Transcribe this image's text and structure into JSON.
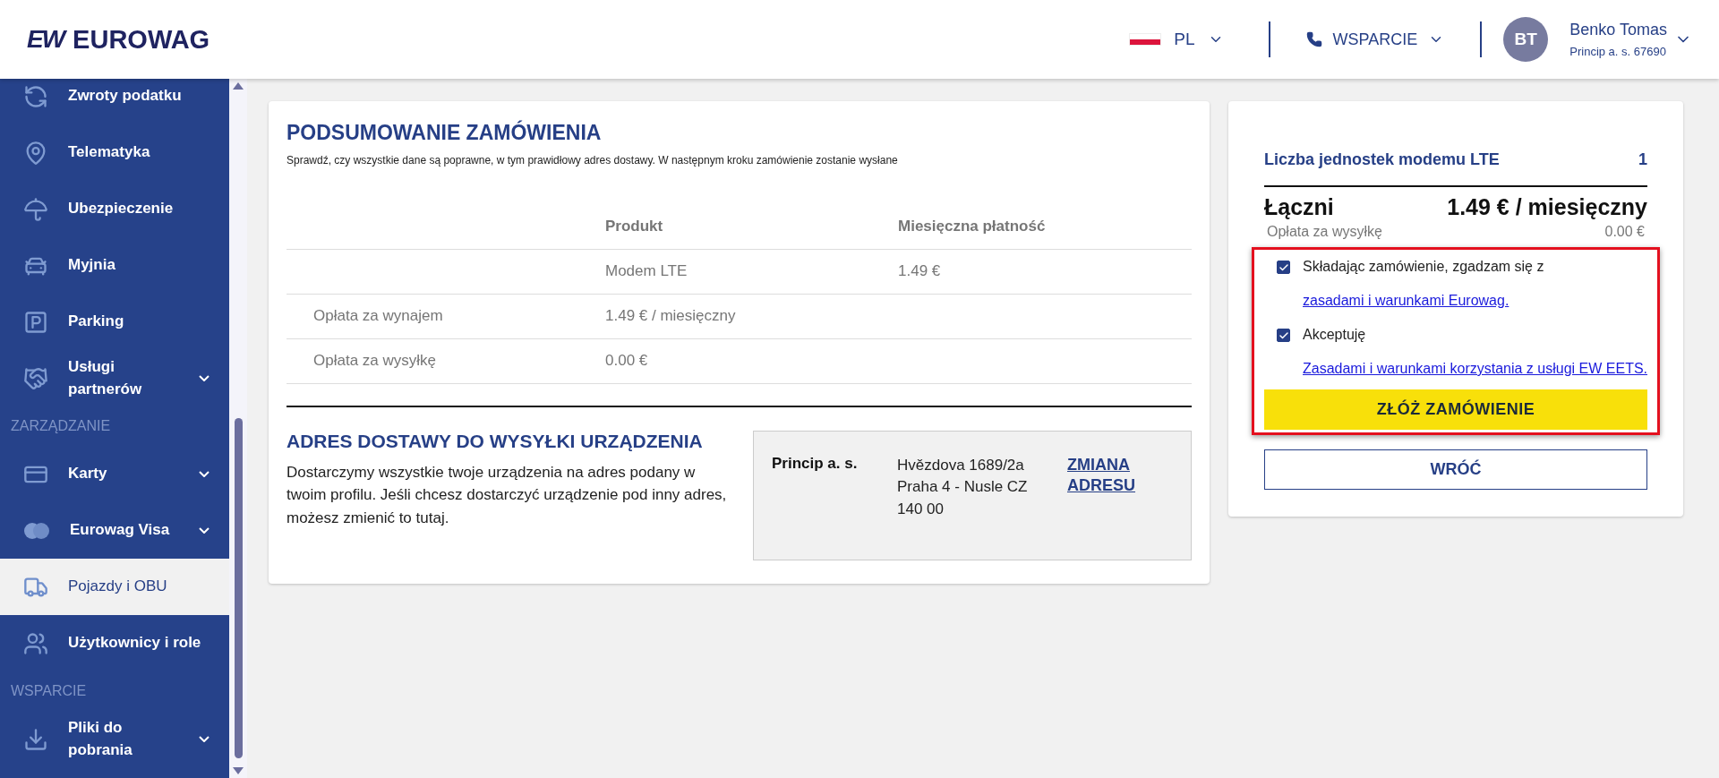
{
  "header": {
    "logo_mark": "EW",
    "logo_text": "EUROWAG",
    "language": "PL",
    "support": "WSPARCIE",
    "user": {
      "initials": "BT",
      "name": "Benko Tomas",
      "company": "Princip a. s. 67690"
    }
  },
  "sidebar": {
    "items": [
      {
        "kind": "item",
        "label": "Zwroty podatku",
        "expandable": false,
        "selected": false
      },
      {
        "kind": "item",
        "label": "Telematyka",
        "expandable": false,
        "selected": false
      },
      {
        "kind": "item",
        "label": "Ubezpieczenie",
        "expandable": false,
        "selected": false
      },
      {
        "kind": "item",
        "label": "Myjnia",
        "expandable": false,
        "selected": false
      },
      {
        "kind": "item",
        "label": "Parking",
        "expandable": false,
        "selected": false
      },
      {
        "kind": "item",
        "label": "Usługi partnerów",
        "expandable": true,
        "selected": false
      },
      {
        "kind": "section",
        "label": "ZARZĄDZANIE"
      },
      {
        "kind": "item",
        "label": "Karty",
        "expandable": true,
        "selected": false
      },
      {
        "kind": "item",
        "label": "Eurowag Visa",
        "expandable": true,
        "selected": false
      },
      {
        "kind": "item",
        "label": "Pojazdy i OBU",
        "expandable": false,
        "selected": true
      },
      {
        "kind": "item",
        "label": "Użytkownicy i role",
        "expandable": false,
        "selected": false
      },
      {
        "kind": "section",
        "label": "WSPARCIE"
      },
      {
        "kind": "item",
        "label": "Pliki do pobrania",
        "expandable": true,
        "selected": false
      }
    ]
  },
  "summary": {
    "title": "PODSUMOWANIE ZAMÓWIENIA",
    "note": "Sprawdź, czy wszystkie dane są poprawne, w tym prawidłowy adres dostawy. W następnym kroku zamówienie zostanie wysłane",
    "table": {
      "columns": [
        "",
        "Produkt",
        "Miesięczna płatność"
      ],
      "rows": [
        [
          "",
          "Modem LTE",
          "1.49 €"
        ],
        [
          "Opłata za wynajem",
          "1.49 € / miesięczny",
          ""
        ],
        [
          "Opłata za wysyłkę",
          "0.00 €",
          ""
        ]
      ]
    }
  },
  "address": {
    "title": "ADRES DOSTAWY DO WYSYŁKI URZĄDZENIA",
    "text": "Dostarczymy wszystkie twoje urządzenia na adres podany w twoim profilu. Jeśli chcesz dostarczyć urządzenie pod inny adres, możesz zmienić to tutaj.",
    "company": "Princip a. s.",
    "lines": [
      "Hvězdova 1689/2a",
      "Praha 4 - Nusle CZ 140 00"
    ],
    "change_link": "ZMIANA ADRESU"
  },
  "order": {
    "units_label": "Liczba jednostek modemu LTE",
    "units_value": "1",
    "total_label": "Łączni",
    "total_value": "1.49 € / miesięczny",
    "shipping_label": "Opłata za wysyłkę",
    "shipping_value": "0.00 €",
    "consents": [
      {
        "checked": true,
        "text": "Składając zamówienie, zgadzam się z ",
        "link": "zasadami i warunkami Eurowag."
      },
      {
        "checked": true,
        "text": "Akceptuję ",
        "link": "Zasadami i warunkami korzystania z usługi EW EETS."
      }
    ],
    "submit": "ZŁÓŻ ZAMÓWIENIE",
    "back": "WRÓĆ"
  }
}
